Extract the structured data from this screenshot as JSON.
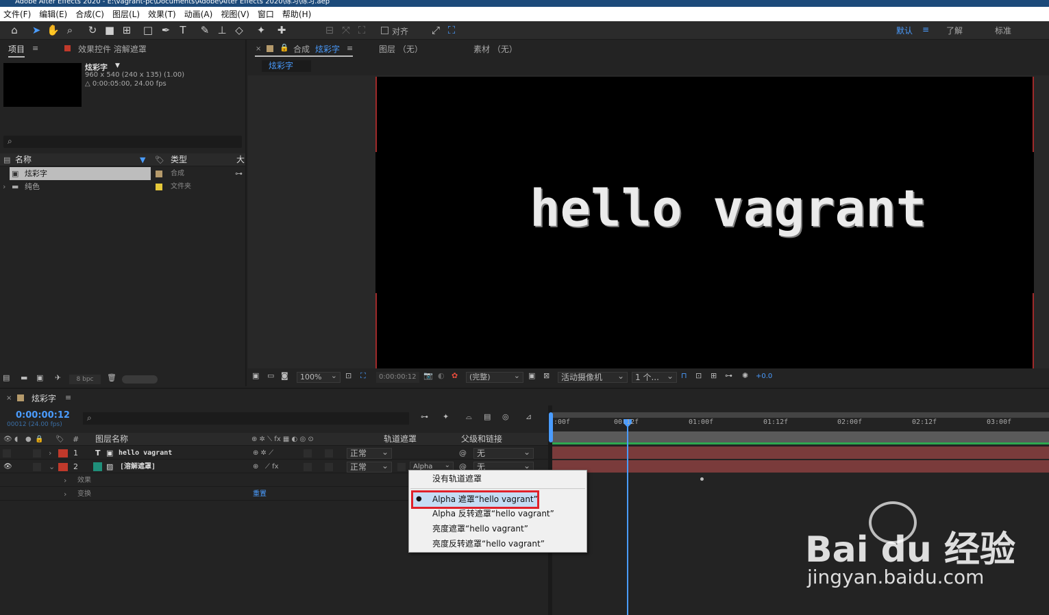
{
  "app": {
    "title": "Adobe After Effects 2020 - E:\\vagrant-pc\\Documents\\Adobe\\After Effects 2020\\练习\\练习.aep"
  },
  "menu": [
    "文件(F)",
    "编辑(E)",
    "合成(C)",
    "图层(L)",
    "效果(T)",
    "动画(A)",
    "视图(V)",
    "窗口",
    "帮助(H)"
  ],
  "toolbar": {
    "align_label": "对齐",
    "workspaces": [
      "默认",
      "了解",
      "标准"
    ]
  },
  "project": {
    "tab": "项目",
    "effects_tab": "效果控件 溶解遮罩",
    "item_name": "炫彩字",
    "item_size": "960 x 540  (240 x 135) (1.00)",
    "item_duration": "△ 0:00:05:00, 24.00 fps",
    "search_placeholder": "",
    "columns": {
      "name": "名称",
      "type": "类型",
      "size": "大"
    },
    "items": [
      {
        "name": "炫彩字",
        "type": "合成",
        "color": "#b59a6b"
      },
      {
        "name": "纯色",
        "type": "文件夹",
        "color": "#e6c93a"
      }
    ],
    "bpc": "8 bpc"
  },
  "comp": {
    "tab_prefix": "合成",
    "tab_name": "炫彩字",
    "layer_tab": "图层 （无）",
    "footage_tab": "素材 （无）",
    "breadcrumb": "炫彩字",
    "viewer_text": "hello vagrant",
    "zoom": "100%",
    "timecode": "0:00:00:12",
    "resolution": "(完整)",
    "camera": "活动摄像机",
    "views": "1 个...",
    "exposure": "+0.0"
  },
  "timeline": {
    "tab": "炫彩字",
    "timecode": "0:00:00:12",
    "frames": "00012 (24.00 fps)",
    "search_placeholder": "",
    "columns": {
      "num": "#",
      "layer_name": "图层名称",
      "track_matte": "轨道遮罩",
      "parent": "父级和链接"
    },
    "layers": [
      {
        "num": "1",
        "name": "hello vagrant",
        "mode": "正常",
        "matte": "",
        "parent": "无",
        "color": "#c0392b"
      },
      {
        "num": "2",
        "name": "[溶解遮罩]",
        "mode": "正常",
        "matte": "Alpha",
        "parent": "无",
        "color": "#c0392b"
      }
    ],
    "sub_rows": [
      {
        "label": "效果"
      },
      {
        "label": "变换",
        "value": "重置"
      }
    ],
    "ruler": [
      ":00f",
      "00:12f",
      "01:00f",
      "01:12f",
      "02:00f",
      "02:12f",
      "03:00f"
    ]
  },
  "context_menu": {
    "items": [
      "没有轨道遮罩",
      "Alpha 遮罩“hello vagrant”",
      "Alpha 反转遮罩“hello vagrant”",
      "亮度遮罩“hello vagrant”",
      "亮度反转遮罩“hello vagrant”"
    ],
    "selected_index": 1
  },
  "watermark": {
    "brand": "Bai du 经验",
    "url": "jingyan.baidu.com"
  }
}
